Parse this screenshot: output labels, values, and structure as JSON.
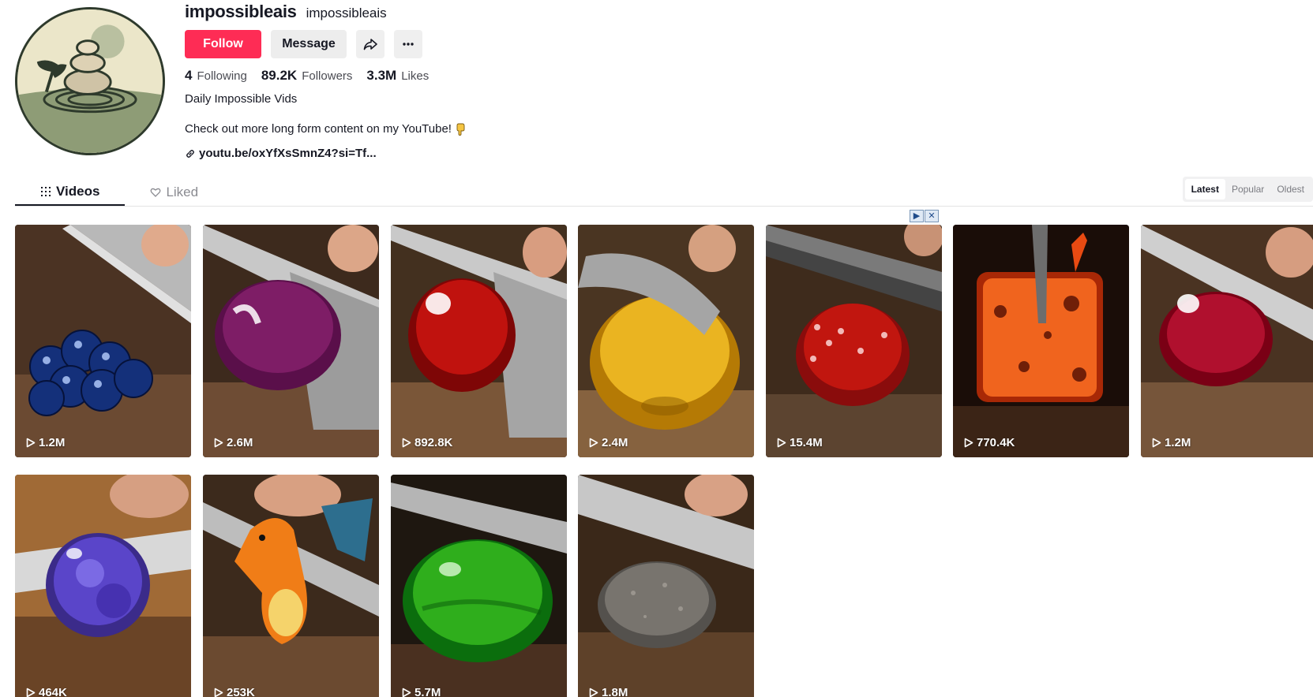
{
  "profile": {
    "username": "impossibleais",
    "nickname": "impossibleais",
    "follow_label": "Follow",
    "message_label": "Message",
    "share_icon": "share-icon",
    "more_icon": "more-icon",
    "stats": {
      "following_count": "4",
      "following_label": "Following",
      "followers_count": "89.2K",
      "followers_label": "Followers",
      "likes_count": "3.3M",
      "likes_label": "Likes"
    },
    "bio_line1": "Daily Impossible Vids",
    "bio_line2": "Check out more long form content on my YouTube!",
    "link_text": "youtu.be/oxYfXsSmnZ4?si=Tf..."
  },
  "tabs": [
    {
      "label": "Videos",
      "icon": "grid-icon"
    },
    {
      "label": "Liked",
      "icon": "heart-outline-icon"
    }
  ],
  "sort": {
    "latest": "Latest",
    "popular": "Popular",
    "oldest": "Oldest"
  },
  "videos": [
    {
      "views": "1.2M",
      "subject": "blueberry cluster"
    },
    {
      "views": "2.6M",
      "subject": "purple onion"
    },
    {
      "views": "892.8K",
      "subject": "red apple"
    },
    {
      "views": "2.4M",
      "subject": "golden amber"
    },
    {
      "views": "15.4M",
      "subject": "strawberry"
    },
    {
      "views": "770.4K",
      "subject": "glowing cube"
    },
    {
      "views": "1.2M",
      "subject": "red gem"
    },
    {
      "views": "464K",
      "subject": "purple orb"
    },
    {
      "views": "253K",
      "subject": "orange dragon"
    },
    {
      "views": "5.7M",
      "subject": "green gem"
    },
    {
      "views": "1.8M",
      "subject": "stone"
    }
  ],
  "colors": {
    "accent": "#fe2c55",
    "text": "#161823",
    "muted": "#8a8b91"
  }
}
